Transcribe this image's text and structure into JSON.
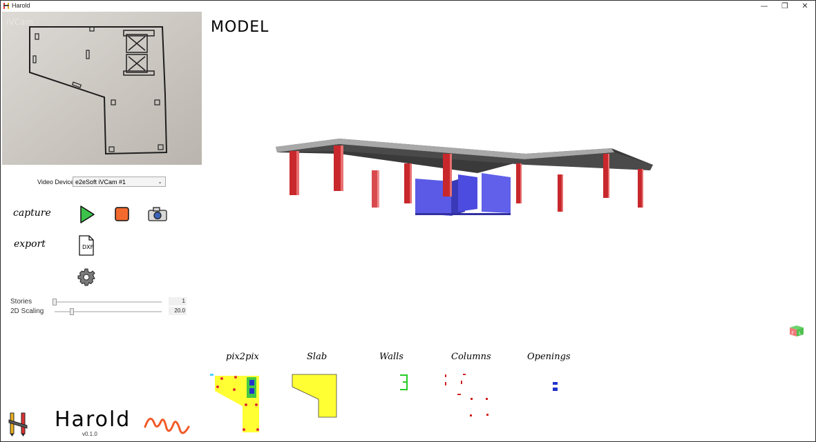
{
  "window": {
    "title": "Harold",
    "minimize": "—",
    "restore": "❐",
    "close": "✕"
  },
  "camera": {
    "overlay_text": "iVCam"
  },
  "video_device": {
    "label": "Video Device",
    "selected": "e2eSoft iVCam #1"
  },
  "controls": {
    "capture_label": "capture",
    "export_label": "export",
    "dxf_text": "DXF"
  },
  "sliders": [
    {
      "label": "Stories",
      "value": "1",
      "fraction": 0.0
    },
    {
      "label": "2D Scaling",
      "value": "20.0",
      "fraction": 0.16
    }
  ],
  "model": {
    "title": "MODEL"
  },
  "stages": [
    "pix2pix",
    "Slab",
    "Walls",
    "Columns",
    "Openings"
  ],
  "brand": {
    "name": "Harold",
    "version": "v0.1.0"
  },
  "colors": {
    "column_red": "#c8282c",
    "wall_blue": "#5a5ae6",
    "slab_gray": "#6e6e6e",
    "play_green": "#3cc24a",
    "stop_orange": "#f26a2e",
    "thumb_yellow": "#ffff33",
    "brand_orange": "#f05a28"
  }
}
